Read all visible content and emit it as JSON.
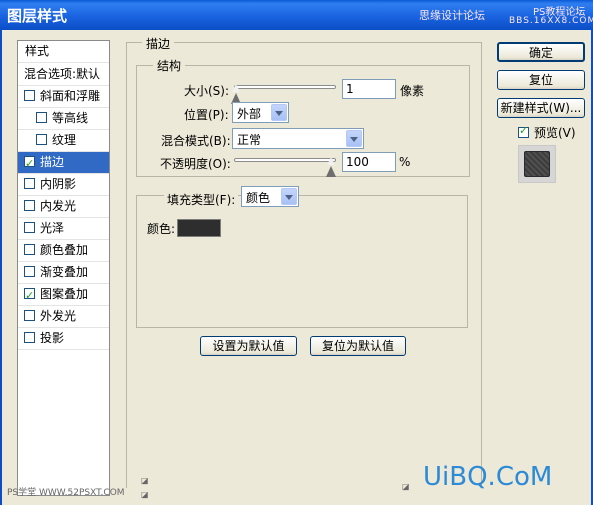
{
  "window": {
    "title": "图层样式",
    "watermark_top": "思缘设计论坛",
    "watermark_top_sub": "PS教程论坛",
    "watermark_top_url": "BBS.16XX8.COM"
  },
  "style_list": {
    "header": "样式",
    "items": [
      {
        "label": "混合选项:默认",
        "checkbox": false,
        "checked": false,
        "indent": false,
        "selected": false
      },
      {
        "label": "斜面和浮雕",
        "checkbox": true,
        "checked": false,
        "indent": false,
        "selected": false
      },
      {
        "label": "等高线",
        "checkbox": true,
        "checked": false,
        "indent": true,
        "selected": false
      },
      {
        "label": "纹理",
        "checkbox": true,
        "checked": false,
        "indent": true,
        "selected": false
      },
      {
        "label": "描边",
        "checkbox": true,
        "checked": true,
        "indent": false,
        "selected": true
      },
      {
        "label": "内阴影",
        "checkbox": true,
        "checked": false,
        "indent": false,
        "selected": false
      },
      {
        "label": "内发光",
        "checkbox": true,
        "checked": false,
        "indent": false,
        "selected": false
      },
      {
        "label": "光泽",
        "checkbox": true,
        "checked": false,
        "indent": false,
        "selected": false
      },
      {
        "label": "颜色叠加",
        "checkbox": true,
        "checked": false,
        "indent": false,
        "selected": false
      },
      {
        "label": "渐变叠加",
        "checkbox": true,
        "checked": false,
        "indent": false,
        "selected": false
      },
      {
        "label": "图案叠加",
        "checkbox": true,
        "checked": true,
        "indent": false,
        "selected": false
      },
      {
        "label": "外发光",
        "checkbox": true,
        "checked": false,
        "indent": false,
        "selected": false
      },
      {
        "label": "投影",
        "checkbox": true,
        "checked": false,
        "indent": false,
        "selected": false
      }
    ]
  },
  "stroke": {
    "section_title": "描边",
    "structure_title": "结构",
    "size_label": "大小(S):",
    "size_value": "1",
    "size_unit": "像素",
    "size_slider_fraction": 0.01,
    "position_label": "位置(P):",
    "position_value": "外部",
    "blend_label": "混合模式(B):",
    "blend_value": "正常",
    "opacity_label": "不透明度(O):",
    "opacity_value": "100",
    "opacity_unit": "%",
    "opacity_slider_fraction": 1.0,
    "fill_type_label": "填充类型(F):",
    "fill_type_value": "颜色",
    "color_label": "颜色:",
    "color_value": "#2e2e2e"
  },
  "buttons": {
    "set_default": "设置为默认值",
    "reset_default": "复位为默认值",
    "ok": "确定",
    "reset": "复位",
    "new_style": "新建样式(W)...",
    "preview": "预览(V)"
  },
  "preview_checked": true,
  "watermark_bottom_left": "PS学堂 WWW.52PSXT.COM",
  "watermark_bottom_right": "UiBQ.CoM"
}
